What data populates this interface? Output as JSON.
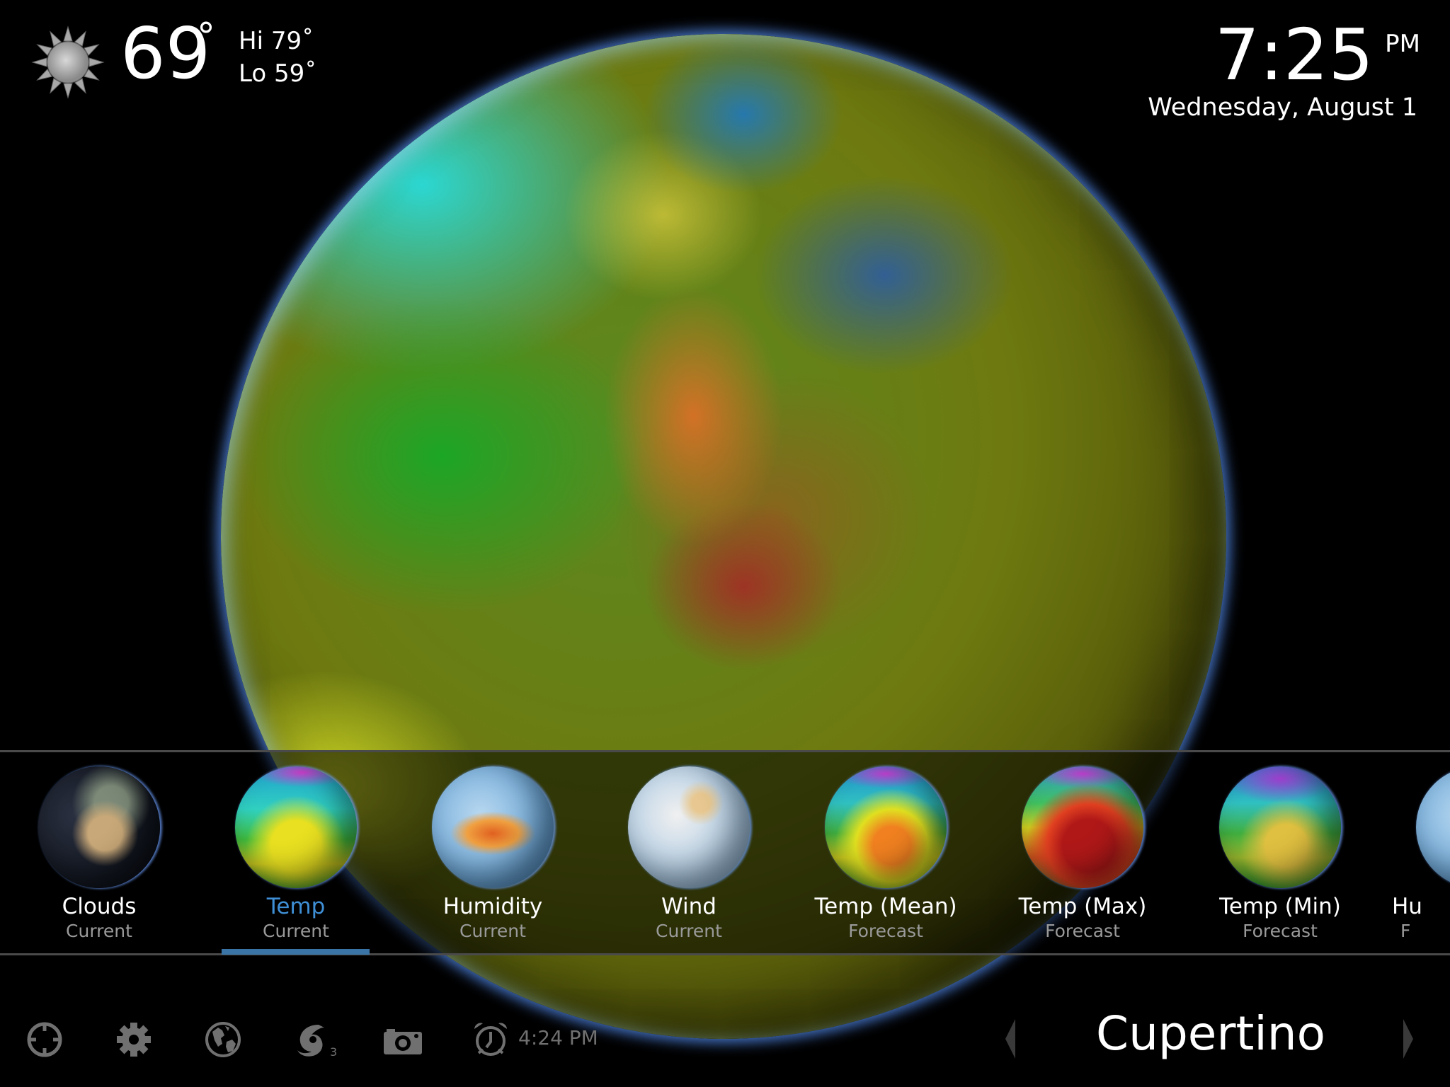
{
  "weather": {
    "icon": "sun-icon",
    "current_temp": "69",
    "degree": "°",
    "hi": "Hi 79˚",
    "lo": "Lo 59˚"
  },
  "clock": {
    "time": "7:25",
    "ampm": "PM",
    "date": "Wednesday, August 1"
  },
  "layers": [
    {
      "title": "Clouds",
      "subtitle": "Current",
      "selected": false
    },
    {
      "title": "Temp",
      "subtitle": "Current",
      "selected": true
    },
    {
      "title": "Humidity",
      "subtitle": "Current",
      "selected": false
    },
    {
      "title": "Wind",
      "subtitle": "Current",
      "selected": false
    },
    {
      "title": "Temp (Mean)",
      "subtitle": "Forecast",
      "selected": false
    },
    {
      "title": "Temp (Max)",
      "subtitle": "Forecast",
      "selected": false
    },
    {
      "title": "Temp (Min)",
      "subtitle": "Forecast",
      "selected": false
    },
    {
      "title": "Hu",
      "subtitle": "F",
      "selected": false
    }
  ],
  "toolbar": {
    "icons": [
      "locate-icon",
      "gear-icon",
      "globe-icon",
      "hurricane-icon",
      "camera-icon",
      "alarm-clock-icon"
    ],
    "hurricane_count": "3",
    "alarm_time": "4:24 PM"
  },
  "location": {
    "city": "Cupertino"
  },
  "colors": {
    "accent": "#3f8fd6",
    "selected_bar": "#3a74a6",
    "icon_gray": "#707070"
  }
}
